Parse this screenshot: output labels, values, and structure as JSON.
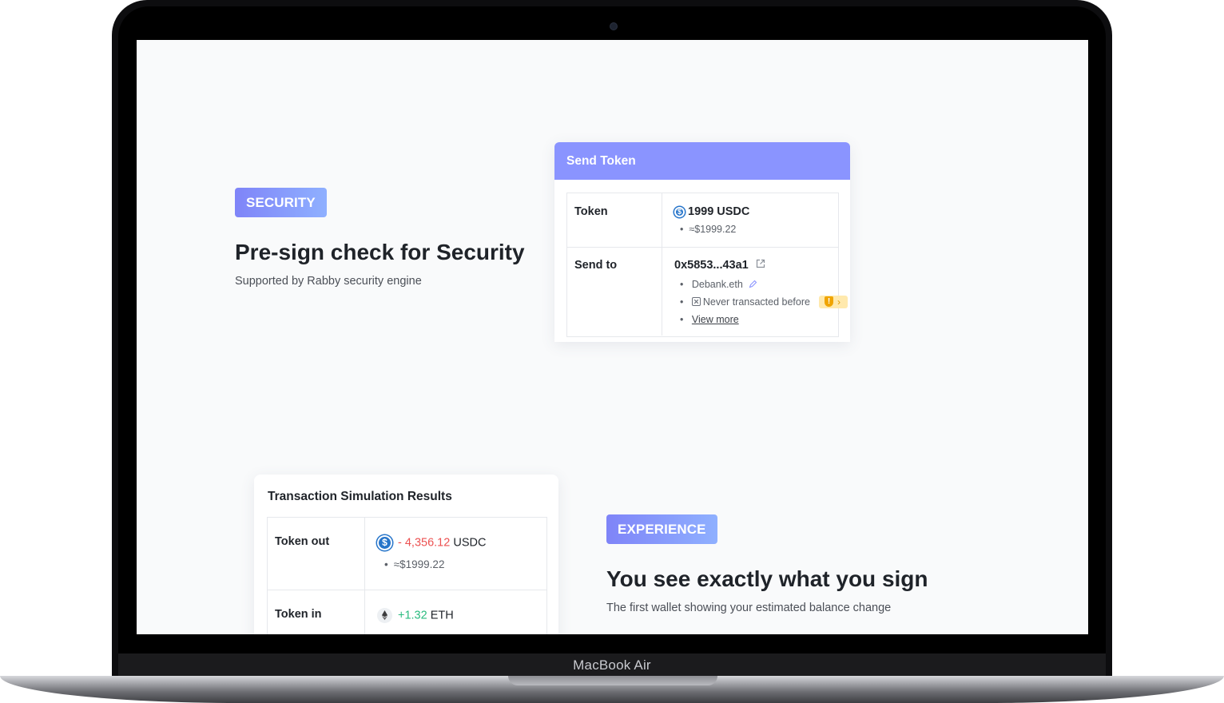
{
  "device": {
    "label": "MacBook Air"
  },
  "security": {
    "tag": "SECURITY",
    "heading": "Pre-sign check for Security",
    "subheading": "Supported by Rabby security engine",
    "card": {
      "title": "Send Token",
      "rows": {
        "token": {
          "label": "Token",
          "value": "1999 USDC",
          "detail": "≈$1999.22"
        },
        "send_to": {
          "label": "Send to",
          "address": "0x5853...43a1",
          "name": "Debank.eth",
          "history": "Never transacted before",
          "more": "View more"
        }
      }
    }
  },
  "experience": {
    "tag": "EXPERIENCE",
    "heading": "You see exactly what you sign",
    "subheading": "The first wallet showing your estimated balance change",
    "card": {
      "title": "Transaction Simulation Results",
      "token_out": {
        "label": "Token out",
        "amount": "- 4,356.12",
        "symbol": "USDC",
        "detail": "≈$1999.22"
      },
      "token_in": {
        "label": "Token in",
        "amount": "+1.32",
        "symbol": "ETH"
      }
    }
  },
  "colors": {
    "accent": "#8a94ff",
    "negative": "#ec5151",
    "positive": "#2abb7f",
    "warning": "#f0a400"
  },
  "icons": [
    "usdc-icon",
    "external-link-icon",
    "edit-pen-icon",
    "close-box-icon",
    "warning-shield-icon",
    "chevron-right-icon",
    "eth-icon"
  ]
}
